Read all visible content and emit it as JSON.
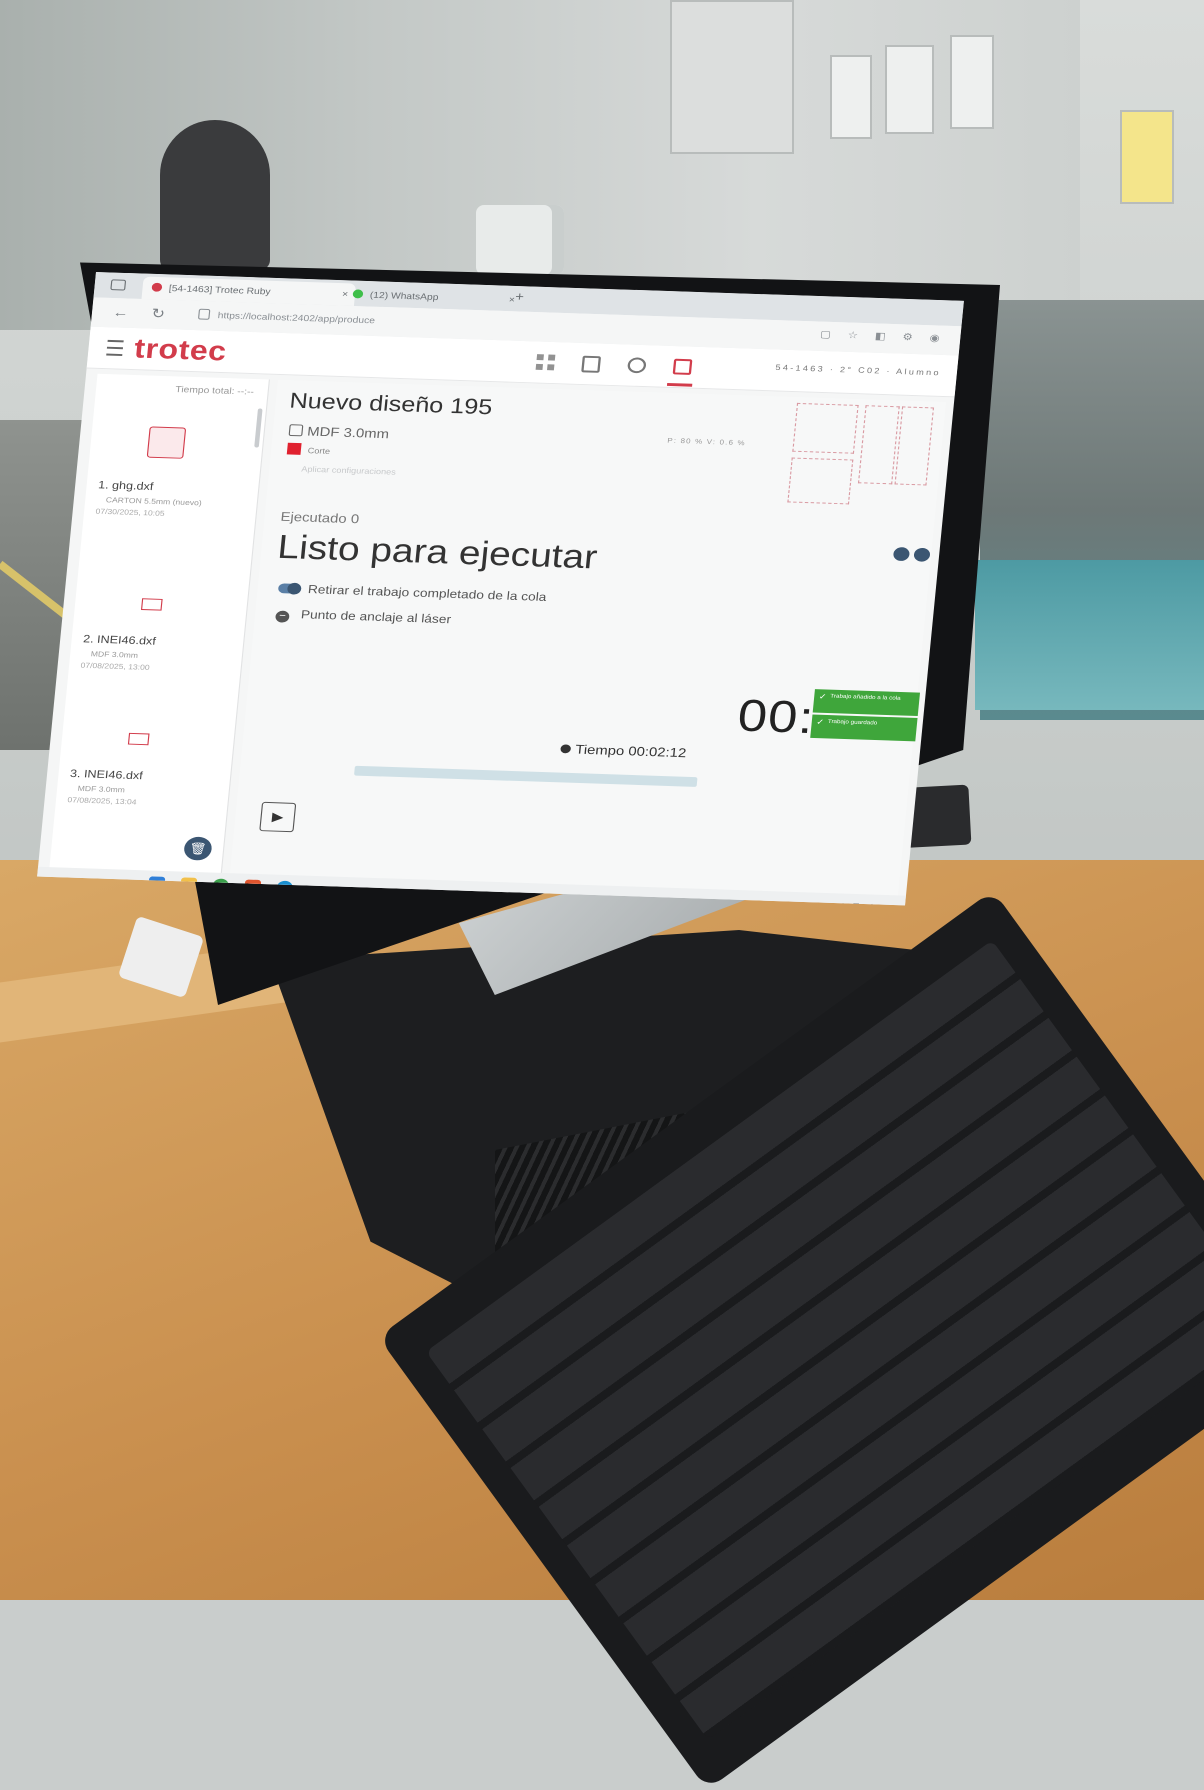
{
  "browser": {
    "tabs": [
      {
        "label": "[54-1463] Trotec Ruby",
        "active": true
      },
      {
        "label": "(12) WhatsApp",
        "active": false
      }
    ],
    "url": "https://localhost:2402/app/produce"
  },
  "app": {
    "logo": "trotec",
    "accent_color": "#d23c4b",
    "header_right": "54-1463 · 2° C02 · Alumno",
    "mode_icons": [
      "grid-icon",
      "edit-icon",
      "target-icon",
      "produce-icon"
    ]
  },
  "queue": {
    "total_time": "Tiempo total: --:--",
    "jobs": [
      {
        "name": "1. ghg.dxf",
        "material": "CARTON 5.5mm (nuevo)",
        "date": "07/30/2025, 10:05"
      },
      {
        "name": "2. INEI46.dxf",
        "material": "MDF 3.0mm",
        "date": "07/08/2025, 13:00"
      },
      {
        "name": "3. INEI46.dxf",
        "material": "MDF 3.0mm",
        "date": "07/08/2025, 13:04"
      }
    ]
  },
  "job": {
    "title": "Nuevo diseño 195",
    "material": "MDF 3.0mm",
    "process": "Corte",
    "process_color": "#e0212f",
    "apply_config": "Aplicar configuraciones",
    "params": "P: 80   %  V: 0.6   %",
    "executed": "Ejecutado 0",
    "status": "Listo para ejecutar",
    "option_retire": "Retirar el trabajo completado de la cola",
    "option_anchor": "Punto de anclaje al láser",
    "time": "Tiempo 00:02:12",
    "timer": "00:",
    "progress": 0
  },
  "notifications": [
    "Trabajo añadido a la cola",
    "Trabajo guardado"
  ]
}
